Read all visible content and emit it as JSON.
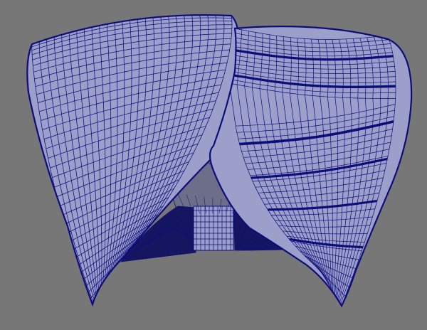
{
  "viewport": {
    "background": "#777777"
  },
  "model": {
    "shape": "turban",
    "style": "wireframe-on-shaded",
    "fill_color": "#9c9fca",
    "shadow_fill_color": "#7f83b3",
    "wire_color": "#0d0d7a",
    "inner_color": "#6d6f8a",
    "cavity_color": "#161660"
  }
}
